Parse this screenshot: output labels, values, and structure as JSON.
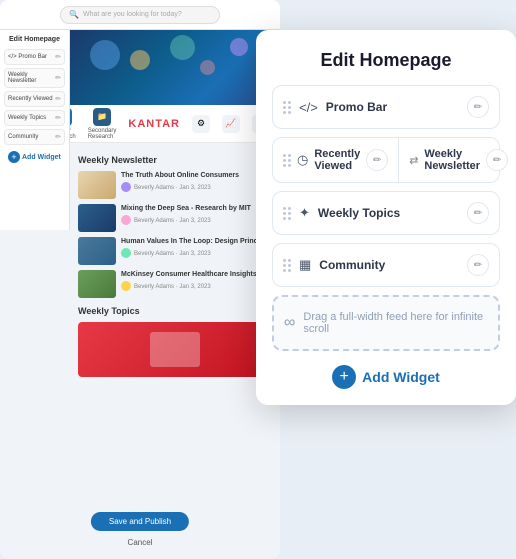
{
  "background": {
    "search_placeholder": "What are you looking for today?",
    "section_weekly_newsletter": "Weekly Newsletter",
    "section_weekly_topics": "Weekly Topics",
    "articles": [
      {
        "title": "The Truth About Online Consumers",
        "meta": "Beverly Adams · Jan 3, 2023",
        "thumb_class": "bg-article-thumb-1"
      },
      {
        "title": "Mixing the Deep Sea - Research by MIT",
        "meta": "Beverly Adams · Jan 3, 2023",
        "thumb_class": "bg-article-thumb-2"
      },
      {
        "title": "Human Values In The Loop: Design Princ...",
        "meta": "Beverly Adams · Jan 3, 2023",
        "thumb_class": "bg-article-thumb-3"
      },
      {
        "title": "McKinsey Consumer Healthcare Insights...",
        "meta": "Beverly Adams · Jan 3, 2023",
        "thumb_class": "bg-article-thumb-4"
      }
    ],
    "nav_items": [
      {
        "label": "Primary Research",
        "color": "#1a6fb5"
      },
      {
        "label": "Secondary Research",
        "color": "#2a5c8a"
      },
      {
        "label": "Kantar",
        "color": "#e63946"
      },
      {
        "label": "",
        "color": "#888"
      },
      {
        "label": "",
        "color": "#888"
      },
      {
        "label": "",
        "color": "#888"
      },
      {
        "label": "",
        "color": "#888"
      }
    ],
    "save_btn": "Save and Publish",
    "cancel": "Cancel"
  },
  "sidebar": {
    "title": "Edit Homepage",
    "items": [
      {
        "label": "</> Promo Bar",
        "icon": "✏"
      },
      {
        "label": "Weekly Newsletter",
        "icon": "✏"
      },
      {
        "label": "Recently Viewed",
        "icon": "✏"
      },
      {
        "label": "Weekly Topics",
        "icon": "✏"
      },
      {
        "label": "Community",
        "icon": "✏"
      }
    ],
    "add_widget": "Add Widget"
  },
  "edit_panel": {
    "title": "Edit Homepage",
    "widgets": [
      {
        "id": "promo-bar",
        "label": "Promo Bar",
        "icon": "</>",
        "editable": true
      },
      {
        "id": "recently-viewed",
        "label": "Recently\nViewed",
        "icon": "◷",
        "editable": true
      },
      {
        "id": "weekly-newsletter",
        "label": "Weekly\nNewsletter",
        "icon": "⇄",
        "editable": true
      },
      {
        "id": "weekly-topics",
        "label": "Weekly Topics",
        "icon": "✦",
        "editable": true
      },
      {
        "id": "community",
        "label": "Community",
        "icon": "▦",
        "editable": true
      }
    ],
    "drop_zone_text": "Drag a full-width feed here for infinite scroll",
    "add_widget_label": "Add Widget"
  }
}
